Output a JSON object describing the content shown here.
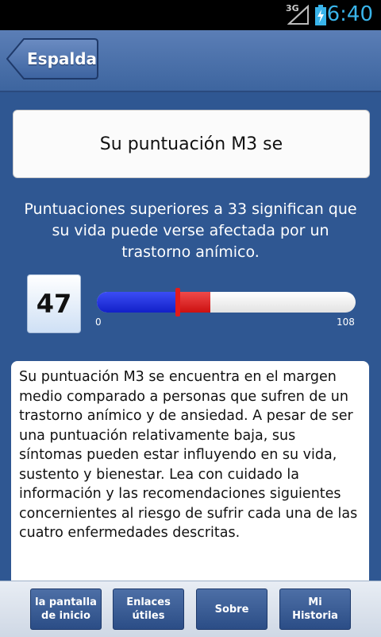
{
  "status_bar": {
    "network": "3G",
    "time": "6:40",
    "signal_icon": "signal-icon",
    "battery_icon": "battery-charging-icon"
  },
  "header": {
    "back_label": "Espalda"
  },
  "result": {
    "title": "Su puntuación M3 se",
    "info": "Puntuaciones superiores a 33 significan que su vida puede verse afectada por un trastorno anímico.",
    "score": "47",
    "scale_min": "0",
    "scale_max": "108",
    "score_value": 47,
    "scale_min_value": 0,
    "scale_max_value": 108,
    "segment_blue_fraction": 0.31,
    "segment_red_fraction": 0.44,
    "colors": {
      "low": "#1a2ee0",
      "high": "#e02020",
      "marker": "#e31b1b"
    }
  },
  "description": "Su puntuación M3 se encuentra en el margen medio comparado a personas que sufren de un trastorno anímico y de ansiedad. A pesar de ser una puntuación relativamente baja, sus síntomas pueden estar influyendo en su vida, sustento y bienestar. Lea con cuidado la información y las recomendaciones siguientes concernientes al riesgo de sufrir cada una de las cuatro enfermedades descritas.",
  "nav": [
    {
      "label": "la pantalla\nde inicio"
    },
    {
      "label": "Enlaces\nútiles"
    },
    {
      "label": "Sobre"
    },
    {
      "label": "Mi\nHistoria"
    }
  ]
}
